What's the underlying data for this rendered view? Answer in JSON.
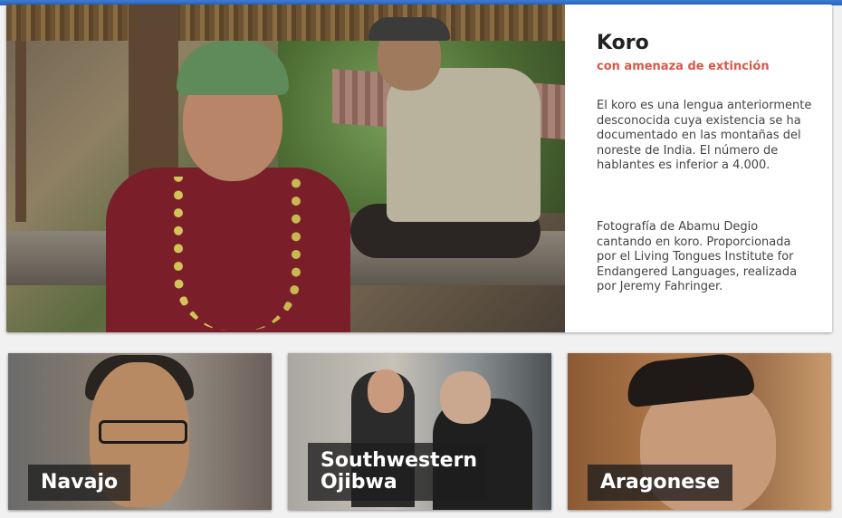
{
  "hero": {
    "title": "Koro",
    "status": "con amenaza de extinción",
    "description": "El koro es una lengua anteriormente desconocida cuya existencia se ha documentado en las montañas del noreste de India. El número de hablantes es inferior a 4.000.",
    "photo_credit": "Fotografía de Abamu Degio cantando en koro. Proporcionada por el Living Tongues Institute for Endangered Languages, realizada por Jeremy Fahringer."
  },
  "cards": [
    {
      "label": "Navajo"
    },
    {
      "label": "Southwestern Ojibwa"
    },
    {
      "label": "Aragonese"
    }
  ],
  "colors": {
    "status_red": "#d9574a",
    "label_bg": "rgba(30,30,30,.78)"
  }
}
